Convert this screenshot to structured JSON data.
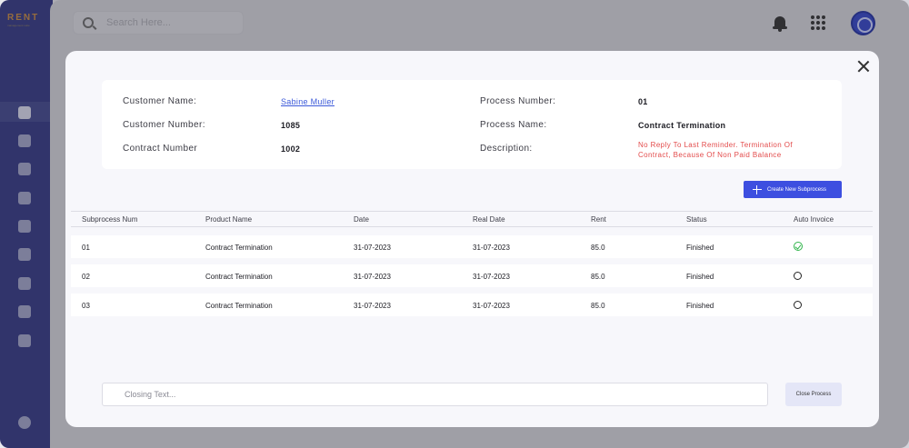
{
  "app": {
    "brand": "RENT",
    "brand_sub": "management suite",
    "search_placeholder": "Search Here..."
  },
  "sidebar": {
    "items": [
      {
        "icon": "home-icon",
        "active": true
      },
      {
        "icon": "document-settings-icon"
      },
      {
        "icon": "file-check-icon"
      },
      {
        "icon": "download-icon"
      },
      {
        "icon": "search-icon"
      },
      {
        "icon": "edit-document-icon"
      },
      {
        "icon": "user-icon"
      },
      {
        "icon": "gear-icon"
      },
      {
        "icon": "calendar-icon"
      },
      {
        "icon": "logout-icon"
      }
    ]
  },
  "modal": {
    "info": {
      "customer_name_label": "Customer Name:",
      "customer_name": "Sabine Muller",
      "customer_number_label": "Customer Number:",
      "customer_number": "1085",
      "contract_number_label": "Contract Number",
      "contract_number": "1002",
      "process_number_label": "Process Number:",
      "process_number": "01",
      "process_name_label": "Process Name:",
      "process_name": "Contract Termination",
      "description_label": "Description:",
      "description": "No Reply To Last Reminder. Termination Of Contract, Because Of Non Paid Balance"
    },
    "create_button": "Create New Subprocess",
    "table": {
      "headers": [
        "Subprocess Num",
        "Product Name",
        "Date",
        "Real Date",
        "Rent",
        "Status",
        "Auto Invoice"
      ],
      "rows": [
        {
          "num": "01",
          "product": "Contract Termination",
          "date": "31-07-2023",
          "real_date": "31-07-2023",
          "rent": "85.0",
          "status": "Finished",
          "auto_invoice": true
        },
        {
          "num": "02",
          "product": "Contract Termination",
          "date": "31-07-2023",
          "real_date": "31-07-2023",
          "rent": "85.0",
          "status": "Finished",
          "auto_invoice": false
        },
        {
          "num": "03",
          "product": "Contract Termination",
          "date": "31-07-2023",
          "real_date": "31-07-2023",
          "rent": "85.0",
          "status": "Finished",
          "auto_invoice": false
        }
      ]
    },
    "closing_placeholder": "Closing Text...",
    "close_process_button": "Close Process"
  },
  "colors": {
    "sidebar": "#2b3180",
    "accent": "#3d4fe0",
    "description": "#e34b4b",
    "success": "#2fb44a"
  }
}
